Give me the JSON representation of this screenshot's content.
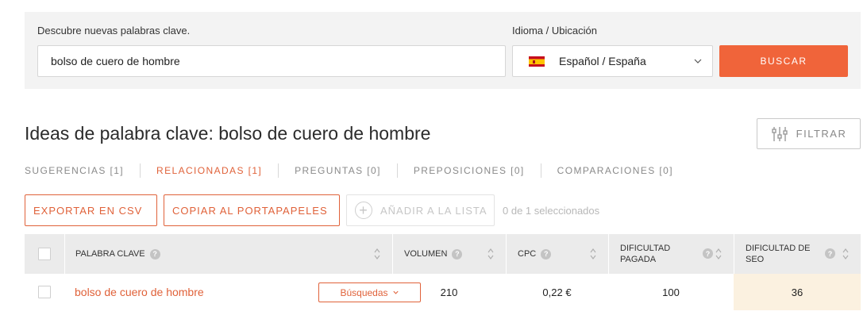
{
  "search": {
    "label": "Descubre nuevas palabras clave.",
    "value": "bolso de cuero de hombre",
    "lang_label": "Idioma / Ubicación",
    "lang_value": "Español / España",
    "flag_icon": "spain-flag-icon",
    "button": "BUSCAR"
  },
  "header": {
    "title": "Ideas de palabra clave: bolso de cuero de hombre",
    "filter_button": "FILTRAR"
  },
  "tabs": [
    {
      "label": "SUGERENCIAS [1]",
      "active": false
    },
    {
      "label": "RELACIONADAS [1]",
      "active": true
    },
    {
      "label": "PREGUNTAS [0]",
      "active": false
    },
    {
      "label": "PREPOSICIONES [0]",
      "active": false
    },
    {
      "label": "COMPARACIONES [0]",
      "active": false
    }
  ],
  "actions": {
    "export": "EXPORTAR EN CSV",
    "copy": "COPIAR AL PORTAPAPELES",
    "add": "AÑADIR A LA LISTA",
    "selected": "0 de 1 seleccionados"
  },
  "table": {
    "columns": {
      "keyword": "PALABRA CLAVE",
      "volume": "VOLUMEN",
      "cpc": "CPC",
      "paid_difficulty_1": "DIFICULTAD",
      "paid_difficulty_2": "PAGADA",
      "seo_difficulty_1": "DIFICULTAD DE",
      "seo_difficulty_2": "SEO"
    },
    "rows": [
      {
        "keyword": "bolso de cuero de hombre",
        "searches_button": "Búsquedas",
        "volume": "210",
        "cpc": "0,22 €",
        "paid_difficulty": "100",
        "seo_difficulty": "36"
      }
    ]
  },
  "colors": {
    "accent": "#f0643a",
    "panel": "#f3f3f3",
    "header_bg": "#ebebeb",
    "seo_cell": "#fbf1e0"
  }
}
